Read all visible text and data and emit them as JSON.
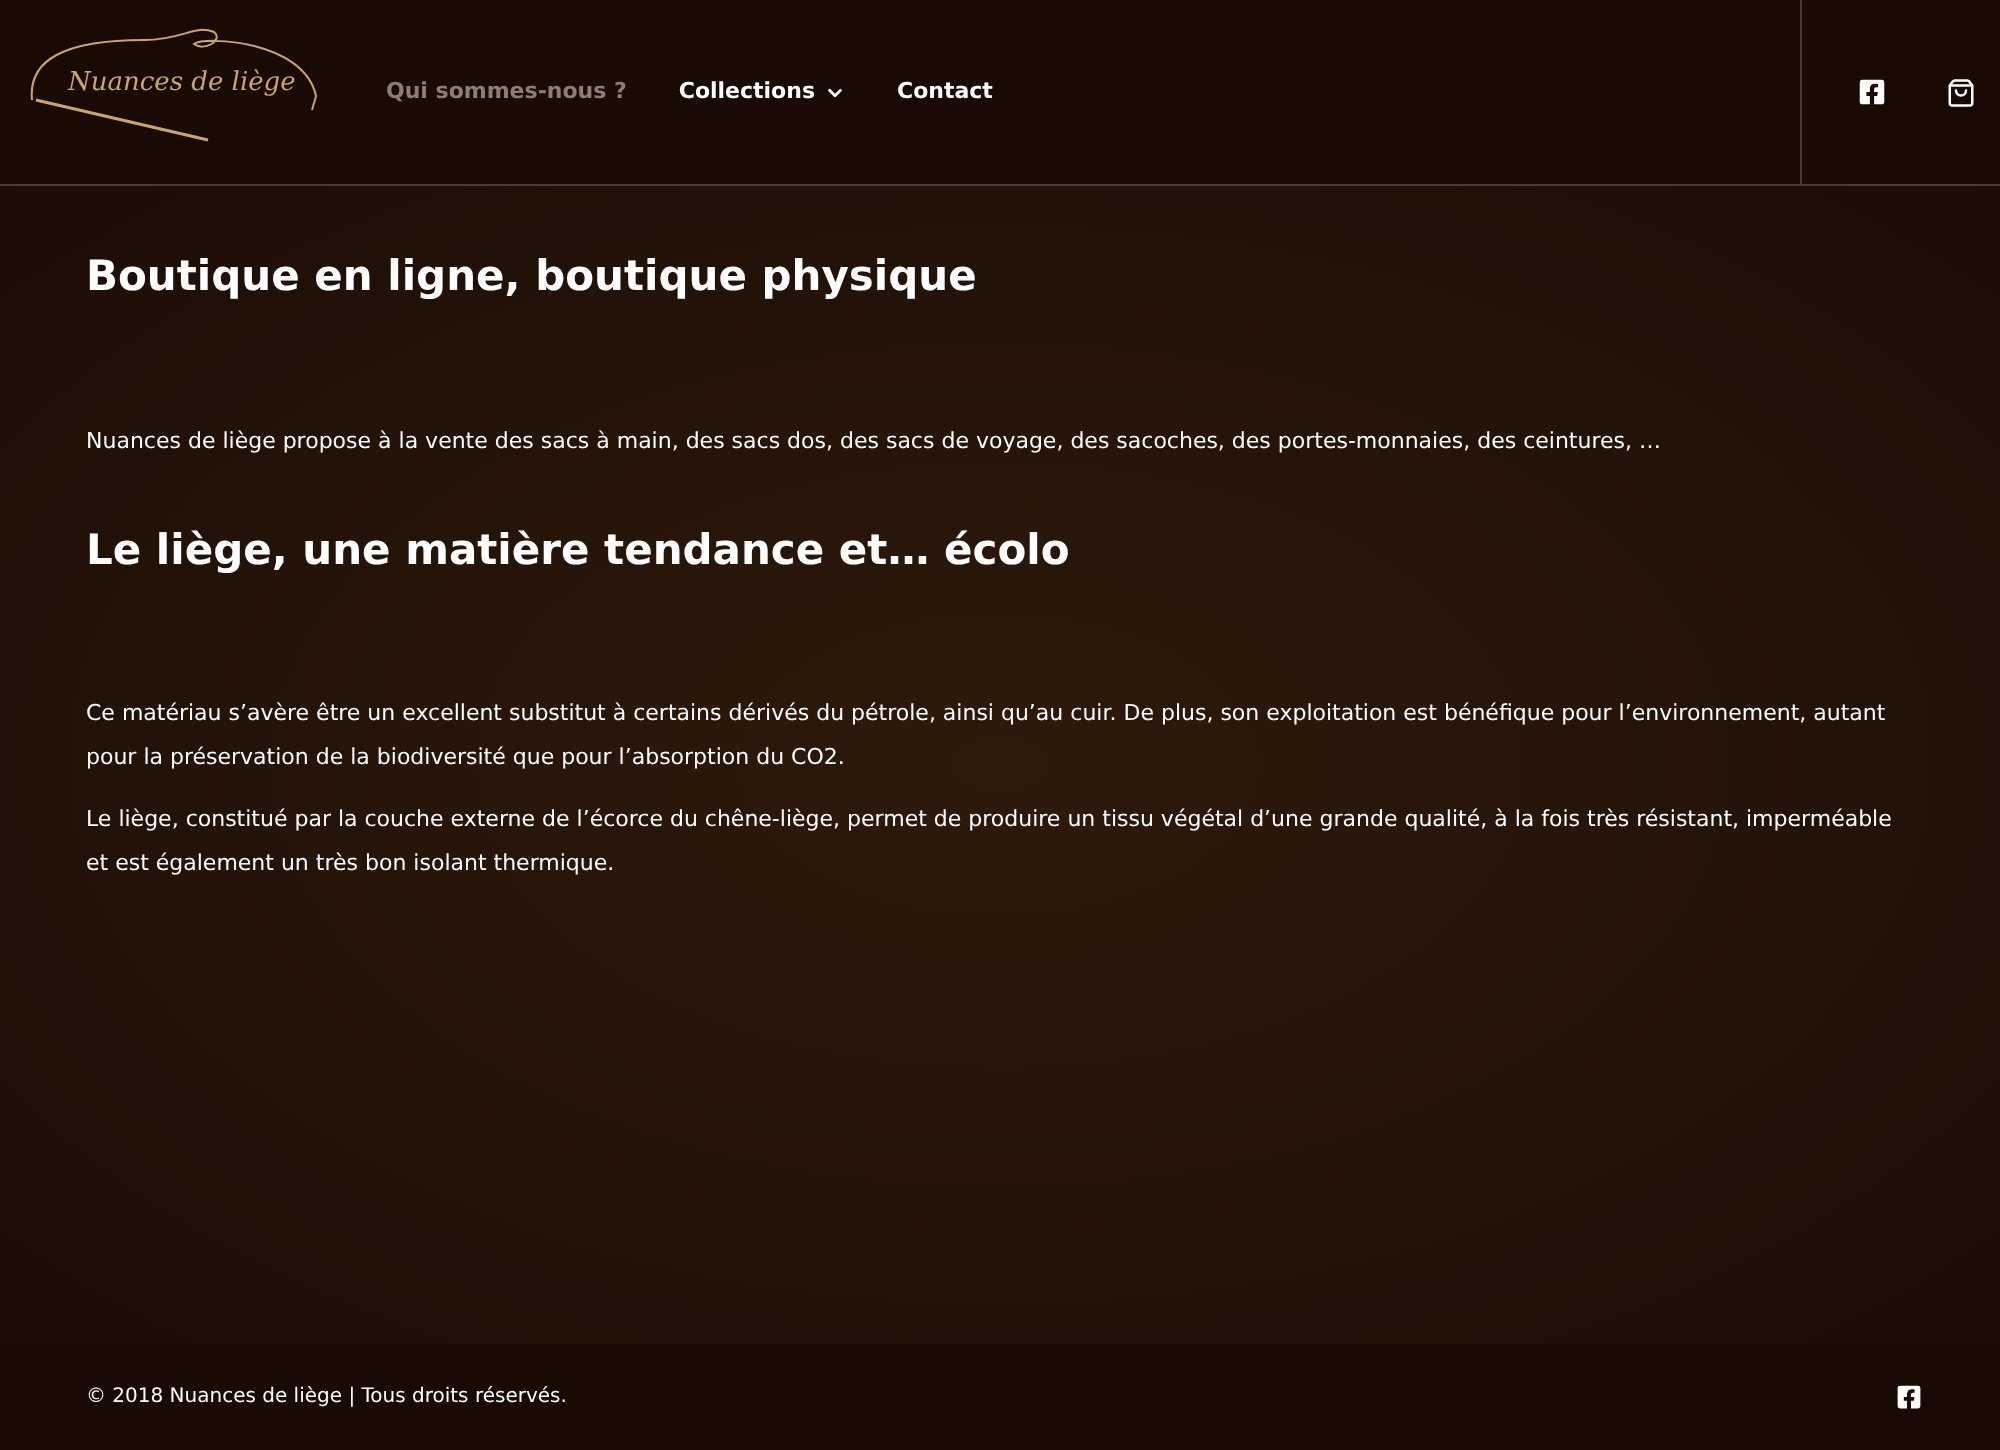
{
  "header": {
    "logo": "Nuances de liège",
    "nav": [
      {
        "label": "Qui sommes-nous ?",
        "selected": true,
        "dropdown": false
      },
      {
        "label": "Collections",
        "selected": false,
        "dropdown": true
      },
      {
        "label": "Contact",
        "selected": false,
        "dropdown": false
      }
    ]
  },
  "sections": [
    {
      "heading": "Boutique en ligne, boutique physique",
      "paragraphs": [
        "Nuances de liège propose à la vente des sacs à main, des sacs dos, des sacs de voyage, des sacoches, des portes-monnaies, des ceintures, …"
      ]
    },
    {
      "heading": "Le liège, une matière tendance et… écolo",
      "paragraphs": [
        "Ce matériau s’avère être un excellent substitut à certains dérivés du pétrole, ainsi qu’au cuir. De plus, son exploitation est bénéfique pour l’environnement, autant pour la préservation de la biodiversité que pour l’absorption du CO2.",
        "Le liège, constitué par la couche externe de l’écorce du chêne-liège, permet de produire un tissu végétal d’une grande qualité, à la fois très résistant, imperméable et est également un très bon isolant thermique."
      ]
    }
  ],
  "footer": {
    "copyright": "© 2018 Nuances de liège | Tous droits réservés."
  }
}
